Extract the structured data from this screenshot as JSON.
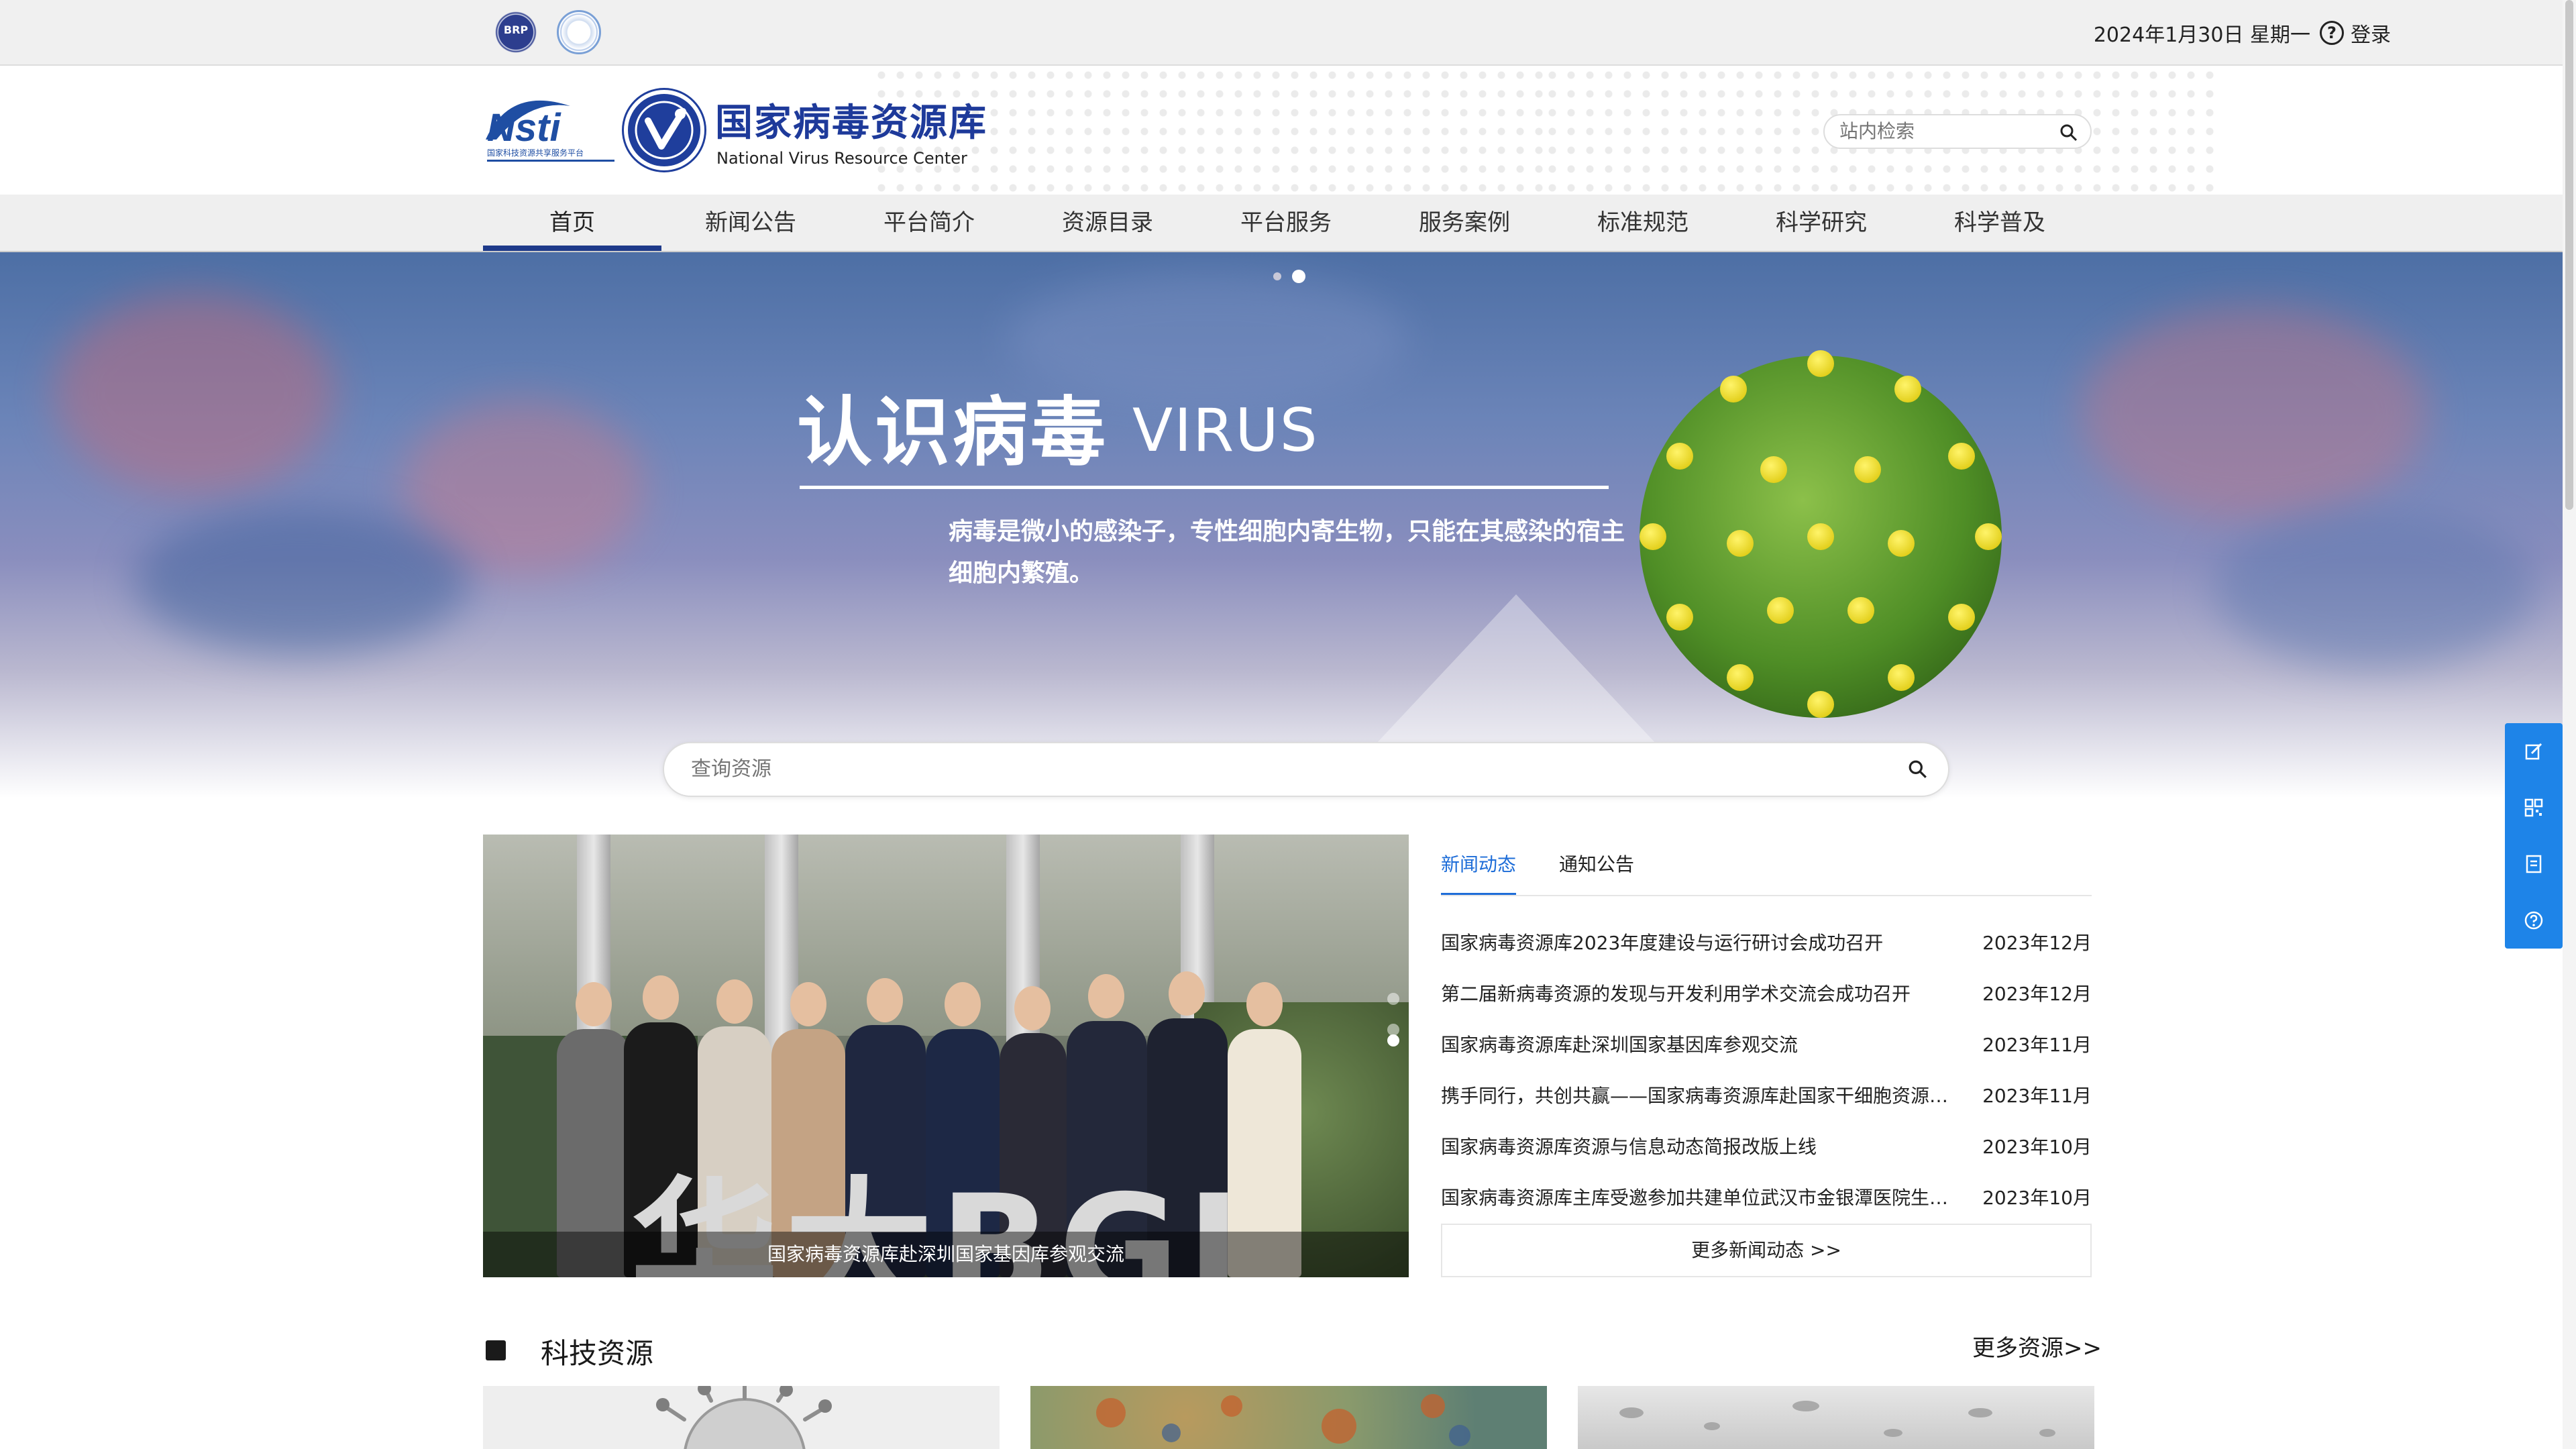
{
  "topbar": {
    "badge1_text": "BRP",
    "date": "2024年1月30日 星期一",
    "help_glyph": "?",
    "login_label": "登录"
  },
  "header": {
    "site_title": "国家病毒资源库",
    "site_subtitle": "National Virus Resource Center",
    "nsti_text": "Nsti",
    "nsti_caption": "国家科技资源共享服务平台",
    "search_placeholder": "站内检索"
  },
  "nav": {
    "items": [
      {
        "label": "首页",
        "active": true
      },
      {
        "label": "新闻公告"
      },
      {
        "label": "平台简介"
      },
      {
        "label": "资源目录"
      },
      {
        "label": "平台服务"
      },
      {
        "label": "服务案例"
      },
      {
        "label": "标准规范"
      },
      {
        "label": "科学研究"
      },
      {
        "label": "科学普及"
      }
    ]
  },
  "banner": {
    "title": "认识病毒",
    "title_en": "VIRUS",
    "description": "病毒是微小的感染子，专性细胞内寄生物，只能在其感染的宿主细胞内繁殖。",
    "slide_count": 2,
    "active_slide": 2
  },
  "resource_search": {
    "placeholder": "查询资源"
  },
  "photo": {
    "caption": "国家病毒资源库赴深圳国家基因库参观交流",
    "sign_text": "华大BGI"
  },
  "news": {
    "tabs": [
      {
        "label": "新闻动态",
        "active": true
      },
      {
        "label": "通知公告"
      }
    ],
    "items": [
      {
        "title": "国家病毒资源库2023年度建设与运行研讨会成功召开",
        "date": "2023年12月"
      },
      {
        "title": "第二届新病毒资源的发现与开发利用学术交流会成功召开",
        "date": "2023年12月"
      },
      {
        "title": "国家病毒资源库赴深圳国家基因库参观交流",
        "date": "2023年11月"
      },
      {
        "title": "携手同行，共创共赢——国家病毒资源库赴国家干细胞资源库交流",
        "date": "2023年11月"
      },
      {
        "title": "国家病毒资源库资源与信息动态简报改版上线",
        "date": "2023年10月"
      },
      {
        "title": "国家病毒资源库主库受邀参加共建单位武汉市金银潭医院生物安全培训",
        "date": "2023年10月"
      }
    ],
    "more_label": "更多新闻动态 >>"
  },
  "resources": {
    "title": "科技资源",
    "more_label": "更多资源>>"
  },
  "sidebar_tools": [
    "edit-icon",
    "qrcode-icon",
    "document-icon",
    "help-icon"
  ],
  "colors": {
    "brand_blue": "#1e3a9a",
    "accent_blue": "#1e6dd8",
    "side_blue": "#1e84e8"
  }
}
